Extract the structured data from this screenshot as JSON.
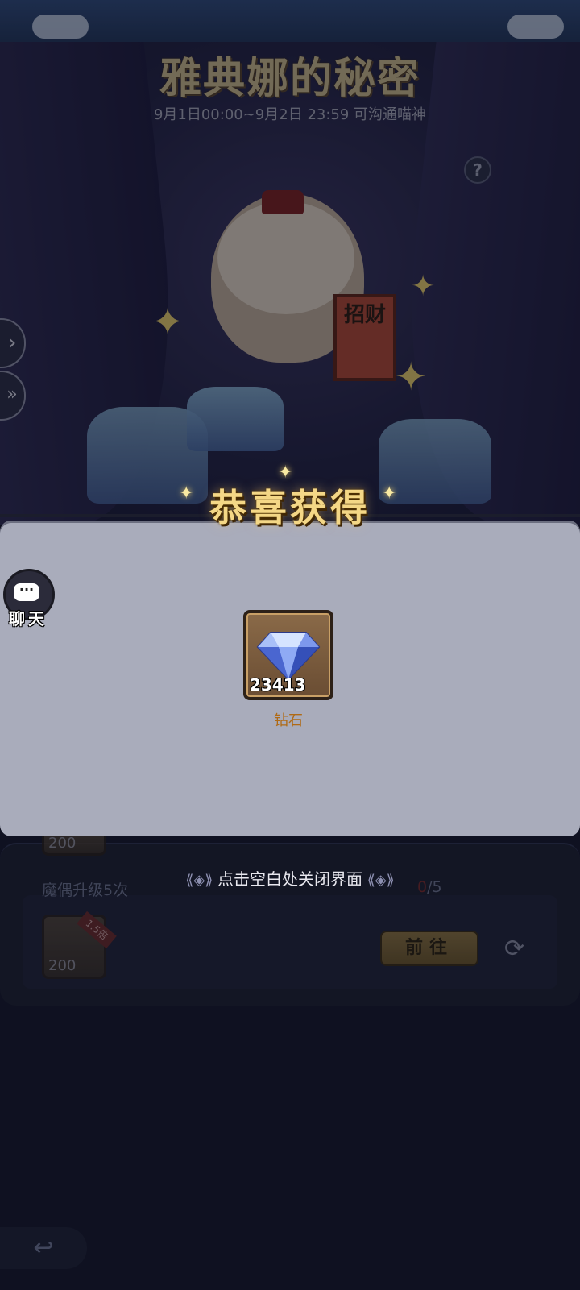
{
  "event": {
    "title": "雅典娜的秘密",
    "time_range": "9月1日00:00~9月2日 23:59 可沟通喵神",
    "sign_text": "招财"
  },
  "modal": {
    "title": "恭喜获得",
    "reward": {
      "count": "23413",
      "name": "钻石",
      "icon": "diamond-icon"
    },
    "close_hint": "点击空白处关闭界面"
  },
  "chat": {
    "label": "聊天",
    "icon": "chat-bubble-icon"
  },
  "tasks": {
    "prev_reward_count": "200",
    "item": {
      "name": "魔偶升级5次",
      "progress_current": "0",
      "progress_total": "/5",
      "reward_count": "200",
      "multiplier_badge": "1.5倍",
      "go_label": "前往"
    }
  },
  "colors": {
    "panel": "#a9acbb",
    "gold_title": "#f4d786",
    "reward_name": "#b06a14"
  }
}
